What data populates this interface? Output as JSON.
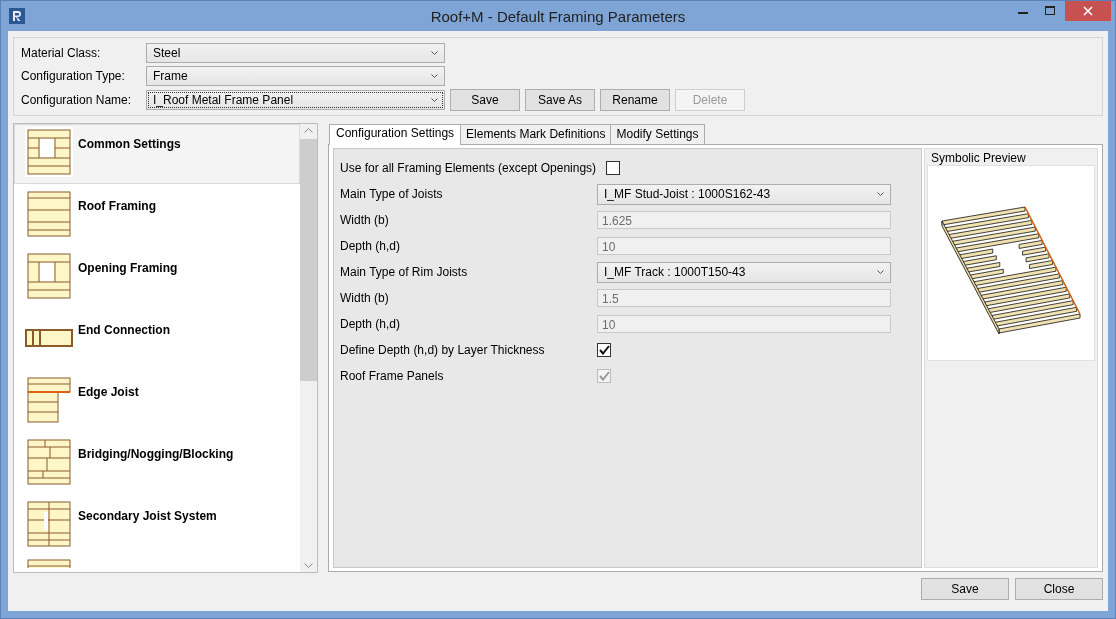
{
  "window": {
    "title": "Roof+M - Default Framing Parameters"
  },
  "header_fields": [
    {
      "label": "Material Class:",
      "value": "Steel",
      "focused": false
    },
    {
      "label": "Configuration Type:",
      "value": "Frame",
      "focused": false
    },
    {
      "label": "Configuration Name:",
      "value": "I_Roof Metal Frame Panel",
      "focused": true
    }
  ],
  "config_buttons": [
    {
      "label": "Save",
      "disabled": false
    },
    {
      "label": "Save As",
      "disabled": false
    },
    {
      "label": "Rename",
      "disabled": false
    },
    {
      "label": "Delete",
      "disabled": true
    }
  ],
  "categories": [
    {
      "label": "Common Settings",
      "selected": true
    },
    {
      "label": "Roof Framing",
      "selected": false
    },
    {
      "label": "Opening Framing",
      "selected": false
    },
    {
      "label": "End Connection",
      "selected": false
    },
    {
      "label": "Edge Joist",
      "selected": false
    },
    {
      "label": "Bridging/Nogging/Blocking",
      "selected": false
    },
    {
      "label": "Secondary Joist System",
      "selected": false
    }
  ],
  "tabs": [
    {
      "label": "Configuration Settings",
      "selected": true
    },
    {
      "label": "Elements Mark Definitions",
      "selected": false
    },
    {
      "label": "Modify Settings",
      "selected": false
    }
  ],
  "settings": [
    {
      "kind": "checkbox",
      "label": "Use for all Framing Elements (except Openings)",
      "checked": false,
      "disabled": false
    },
    {
      "kind": "combo",
      "label": "Main Type of Joists",
      "value": "I_MF Stud-Joist : 1000S162-43"
    },
    {
      "kind": "field",
      "label": "Width (b)",
      "value": "1.625",
      "disabled": true
    },
    {
      "kind": "field",
      "label": "Depth (h,d)",
      "value": "10",
      "disabled": true
    },
    {
      "kind": "combo",
      "label": "Main Type of Rim Joists",
      "value": "I_MF Track : 1000T150-43"
    },
    {
      "kind": "field",
      "label": "Width (b)",
      "value": "1.5",
      "disabled": true
    },
    {
      "kind": "field",
      "label": "Depth (h,d)",
      "value": "10",
      "disabled": true
    },
    {
      "kind": "checkbox",
      "label": "Define Depth (h,d) by Layer Thickness",
      "checked": true,
      "disabled": false
    },
    {
      "kind": "checkbox",
      "label": "Roof Frame Panels",
      "checked": true,
      "disabled": true
    }
  ],
  "preview": {
    "title": "Symbolic Preview"
  },
  "footer_buttons": [
    "Save",
    "Close"
  ]
}
